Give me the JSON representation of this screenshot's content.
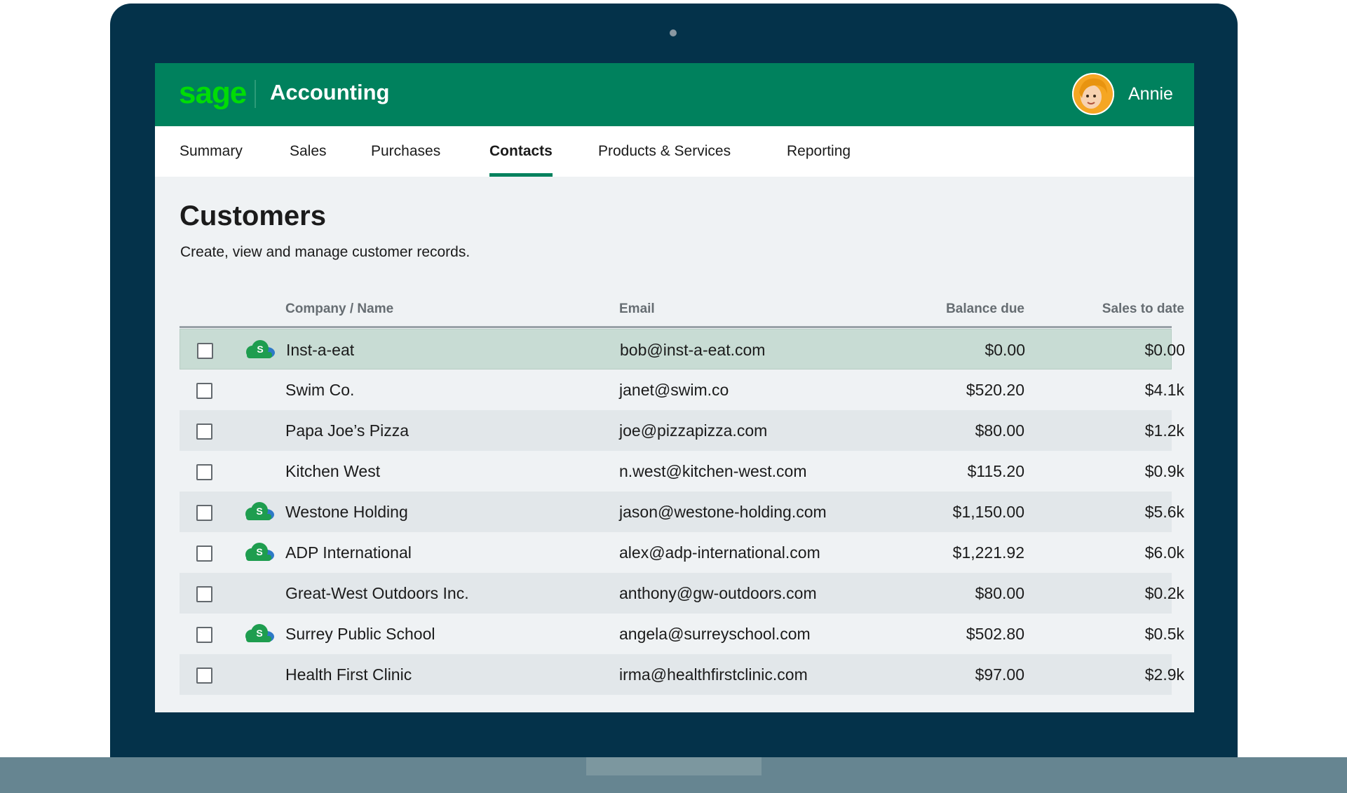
{
  "app": {
    "logo": "sage",
    "title": "Accounting",
    "user_name": "Annie"
  },
  "nav": {
    "items": [
      {
        "label": "Summary",
        "active": false
      },
      {
        "label": "Sales",
        "active": false
      },
      {
        "label": "Purchases",
        "active": false
      },
      {
        "label": "Contacts",
        "active": true
      },
      {
        "label": "Products & Services",
        "active": false
      },
      {
        "label": "Reporting",
        "active": false
      }
    ]
  },
  "page": {
    "title": "Customers",
    "subtitle": "Create, view and manage customer records."
  },
  "table": {
    "columns": [
      "Company / Name",
      "Email",
      "Balance due",
      "Sales to date"
    ],
    "rows": [
      {
        "name": "Inst-a-eat",
        "email": "bob@inst-a-eat.com",
        "balance": "$0.00",
        "sales": "$0.00",
        "cloud": true,
        "selected": true
      },
      {
        "name": "Swim Co.",
        "email": "janet@swim.co",
        "balance": "$520.20",
        "sales": "$4.1k",
        "cloud": false
      },
      {
        "name": "Papa Joe’s Pizza",
        "email": "joe@pizzapizza.com",
        "balance": "$80.00",
        "sales": "$1.2k",
        "cloud": false
      },
      {
        "name": "Kitchen West",
        "email": "n.west@kitchen-west.com",
        "balance": "$115.20",
        "sales": "$0.9k",
        "cloud": false
      },
      {
        "name": "Westone Holding",
        "email": "jason@westone-holding.com",
        "balance": "$1,150.00",
        "sales": "$5.6k",
        "cloud": true
      },
      {
        "name": "ADP International",
        "email": "alex@adp-international.com",
        "balance": "$1,221.92",
        "sales": "$6.0k",
        "cloud": true
      },
      {
        "name": "Great-West Outdoors Inc.",
        "email": "anthony@gw-outdoors.com",
        "balance": "$80.00",
        "sales": "$0.2k",
        "cloud": false
      },
      {
        "name": "Surrey Public School",
        "email": "angela@surreyschool.com",
        "balance": "$502.80",
        "sales": "$0.5k",
        "cloud": true
      },
      {
        "name": "Health First Clinic",
        "email": "irma@healthfirstclinic.com",
        "balance": "$97.00",
        "sales": "$2.9k",
        "cloud": false
      }
    ]
  },
  "icons": {
    "cloud": "sage-cloud-icon",
    "checkbox": "checkbox"
  },
  "colors": {
    "brand_green": "#00815d",
    "logo_green": "#00dc06",
    "selected_row": "#c8dcd4",
    "alt_row": "#e2e7ea",
    "frame": "#04324a"
  }
}
